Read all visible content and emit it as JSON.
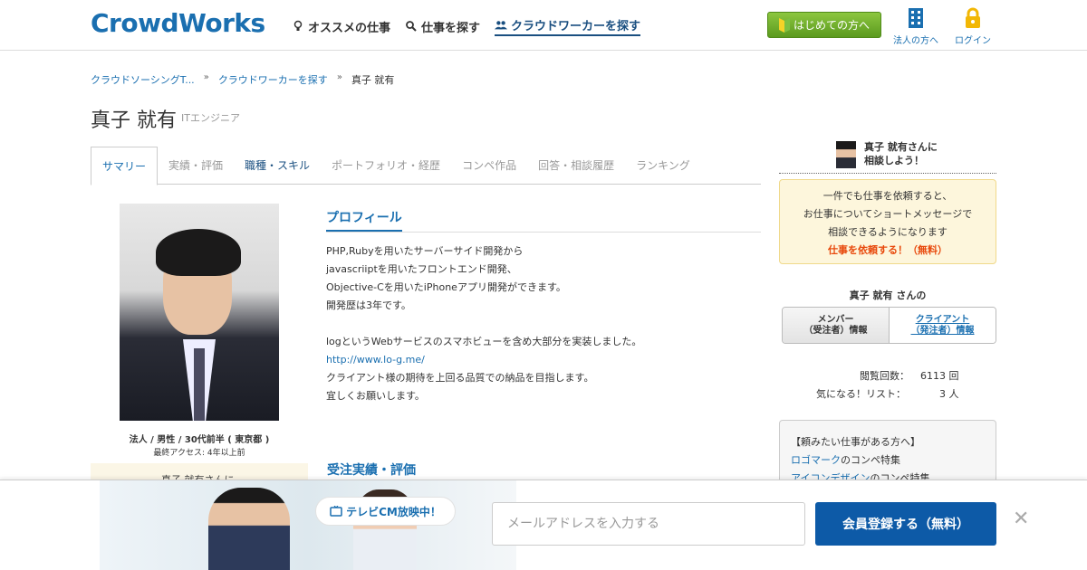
{
  "header": {
    "logo": "CrowdWorks",
    "nav": [
      {
        "label": "オススメの仕事",
        "icon": "lightbulb-icon"
      },
      {
        "label": "仕事を探す",
        "icon": "search-icon"
      },
      {
        "label": "クラウドワーカーを探す",
        "icon": "users-icon"
      }
    ],
    "beginner_button": "はじめての方へ",
    "corp_link": "法人の方へ",
    "login_link": "ログイン"
  },
  "breadcrumb": {
    "items": [
      "クラウドソーシングT...",
      "クラウドワーカーを探す"
    ],
    "separator": "»",
    "current": "真子 就有"
  },
  "profile_header": {
    "name": "真子 就有",
    "occupation": "ITエンジニア"
  },
  "tabs": [
    "サマリー",
    "実績・評価",
    "職種・スキル",
    "ポートフォリオ・経歴",
    "コンペ作品",
    "回答・相談履歴",
    "ランキング"
  ],
  "left": {
    "attributes": "法人 / 男性 / 30代前半 ( 東京都 )",
    "last_access": "最終アクセス: 4年以上前",
    "pale_text": "真子 就有さんに"
  },
  "profile": {
    "heading": "プロフィール",
    "text1": "PHP,Rubyを用いたサーバーサイド開発から\njavascriiptを用いたフロントエンド開発、\nObjective-Cを用いたiPhoneアプリ開発ができます。\n開発歴は3年です。\n\nlogというWebサービスのスマホビューを含め大部分を実装しました。",
    "link": "http://www.lo-g.me/",
    "text2": "\nクライアント様の期待を上回る品質での納品を目指します。\n宜しくお願いします。",
    "jisseki_heading": "受注実績・評価"
  },
  "right": {
    "consult_text": "真子 就有さんに\n相談しよう！",
    "notice": [
      "一件でも仕事を依頼すると、",
      "お仕事についてショートメッセージで",
      "相談できるようになります"
    ],
    "cta": "仕事を依頼する！（無料）",
    "member_label": "真子 就有 さんの",
    "toggle_member": "メンバー\n（受注者）情報",
    "toggle_client": "クライアント\n（発注者）情報",
    "views_label": "閲覧回数：",
    "views_value": "6113 回",
    "fav_label": "気になる！リスト：",
    "fav_value": "3 人",
    "job_box_title": "【頼みたい仕事がある方へ】",
    "job_link1": "ロゴマーク",
    "job_text1": "のコンペ特集",
    "job_link2": "アイコンデザイン",
    "job_text2": "のコンペ特集"
  },
  "banner": {
    "bubble": "テレビCM放映中！",
    "email_placeholder": "メールアドレスを入力する",
    "register_button": "会員登録する（無料）",
    "close": "✕"
  },
  "colors": {
    "brand": "#1a6fb0",
    "accent_orange": "#e8490c",
    "green_button": "#6aa829",
    "register_blue": "#0d5aa7"
  }
}
